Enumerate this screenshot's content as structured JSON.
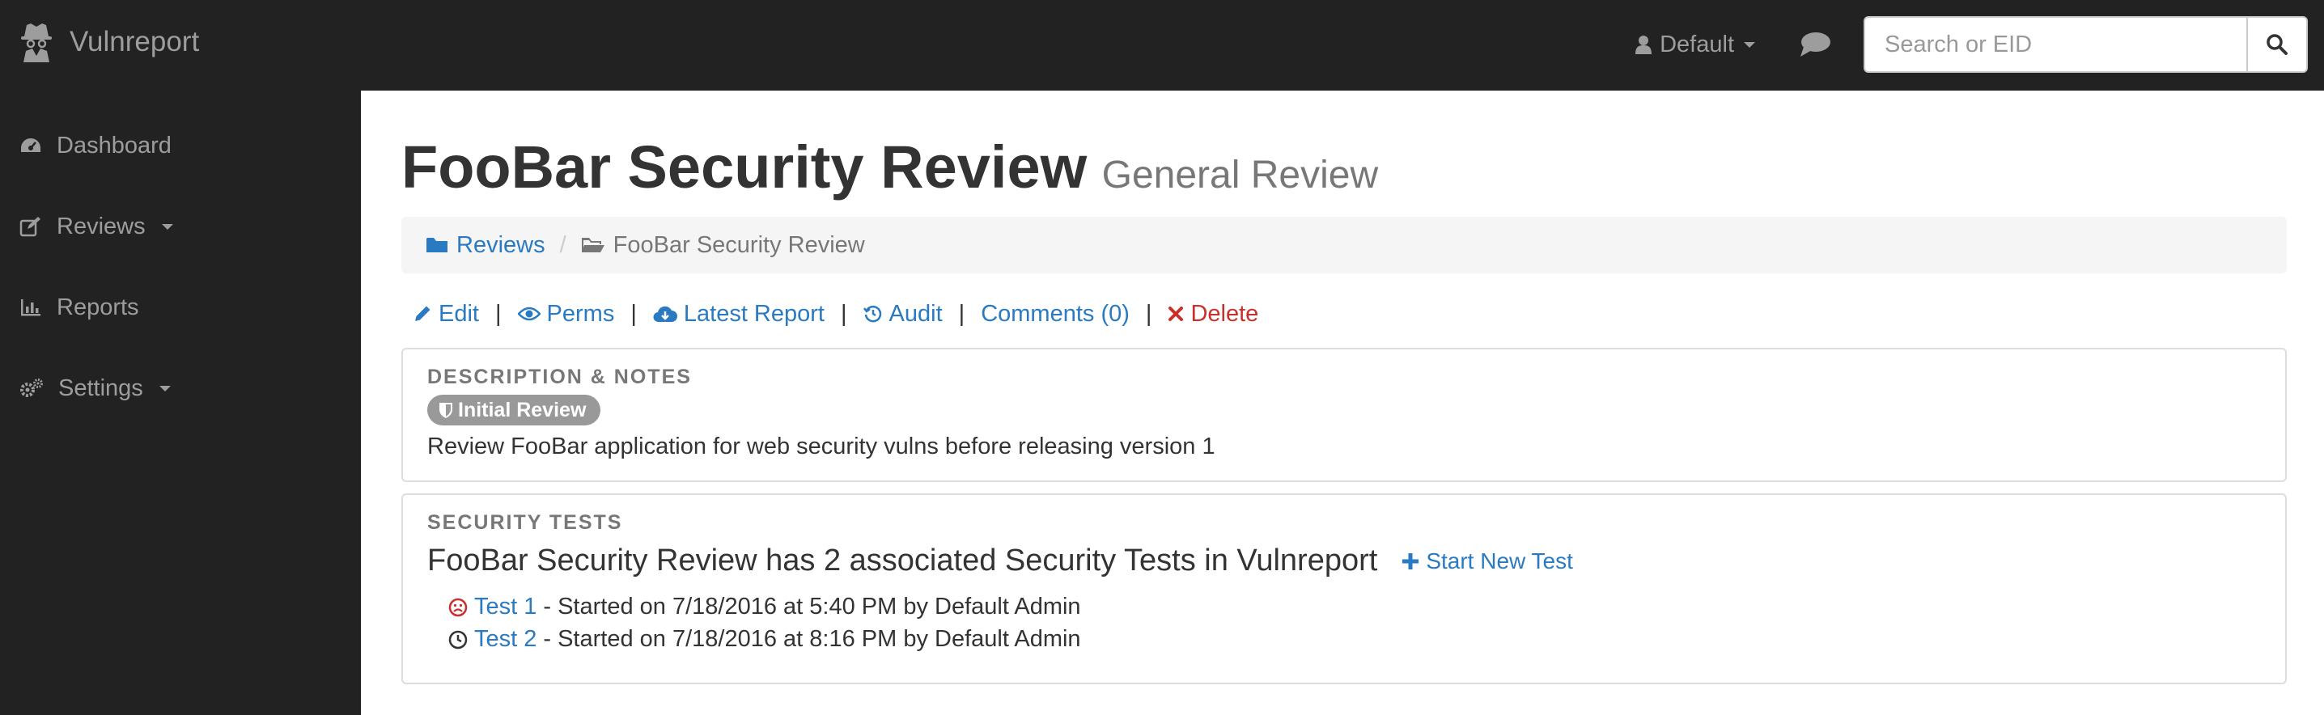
{
  "navbar": {
    "brand": "Vulnreport",
    "user_label": "Default",
    "search_placeholder": "Search or EID"
  },
  "sidebar": {
    "items": [
      {
        "label": "Dashboard",
        "icon": "dashboard-icon",
        "has_caret": false
      },
      {
        "label": "Reviews",
        "icon": "edit-icon",
        "has_caret": true
      },
      {
        "label": "Reports",
        "icon": "bar-chart-icon",
        "has_caret": false
      },
      {
        "label": "Settings",
        "icon": "cogs-icon",
        "has_caret": true
      }
    ]
  },
  "page": {
    "title": "FooBar Security Review",
    "subtitle": "General Review"
  },
  "breadcrumb": {
    "items": [
      {
        "label": "Reviews",
        "icon": "folder-icon",
        "active": false
      },
      {
        "label": "FooBar Security Review",
        "icon": "folder-open-icon",
        "active": true
      }
    ],
    "separator": "/"
  },
  "actions": {
    "separator": "|",
    "items": [
      {
        "label": "Edit",
        "icon": "pencil-icon"
      },
      {
        "label": "Perms",
        "icon": "eye-icon"
      },
      {
        "label": "Latest Report",
        "icon": "cloud-download-icon"
      },
      {
        "label": "Audit",
        "icon": "history-icon"
      },
      {
        "label": "Comments (0)",
        "icon": ""
      },
      {
        "label": "Delete",
        "icon": "times-icon"
      }
    ]
  },
  "description_panel": {
    "label": "DESCRIPTION & NOTES",
    "badge": "Initial Review",
    "badge_icon": "shield-icon",
    "text": "Review FooBar application for web security vulns before releasing version 1"
  },
  "tests_panel": {
    "label": "SECURITY TESTS",
    "heading": "FooBar Security Review has 2 associated Security Tests in Vulnreport",
    "new_test_label": "Start New Test",
    "tests": [
      {
        "name": "Test 1",
        "detail": "- Started on 7/18/2016 at 5:40 PM by Default Admin",
        "status_icon": "frown-icon",
        "status_color": "#c9302c"
      },
      {
        "name": "Test 2",
        "detail": "- Started on 7/18/2016 at 8:16 PM by Default Admin",
        "status_icon": "clock-icon",
        "status_color": "#333333"
      }
    ]
  },
  "colors": {
    "navbar_bg": "#222222",
    "link": "#2a7ac2",
    "danger": "#c9302c",
    "muted": "#777777"
  }
}
